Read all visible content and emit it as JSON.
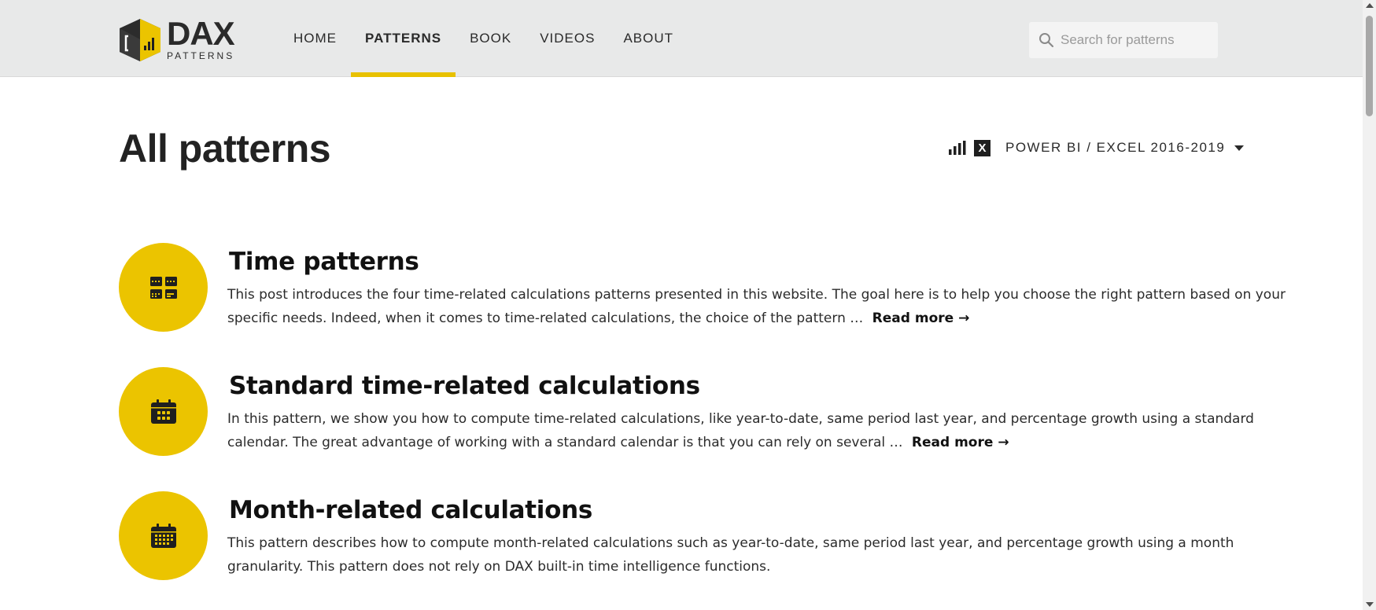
{
  "header": {
    "logo_text": "DAX",
    "logo_sub": "PATTERNS",
    "nav": [
      {
        "label": "HOME",
        "active": false
      },
      {
        "label": "PATTERNS",
        "active": true
      },
      {
        "label": "BOOK",
        "active": false
      },
      {
        "label": "VIDEOS",
        "active": false
      },
      {
        "label": "ABOUT",
        "active": false
      }
    ],
    "search_placeholder": "Search for patterns"
  },
  "page": {
    "title": "All patterns",
    "version_badge": "X",
    "version_label": "POWER BI / EXCEL 2016-2019"
  },
  "patterns": [
    {
      "icon": "calendar-grid-icon",
      "title": "Time patterns",
      "description": "This post introduces the four time-related calculations patterns presented in this website. The goal here is to help you choose the right pattern based on your specific needs. Indeed, when it comes to time-related calculations, the choice of the pattern …",
      "read_more": "Read more"
    },
    {
      "icon": "calendar-icon",
      "title": "Standard time-related calculations",
      "description": "In this pattern, we show you how to compute time-related calculations, like year-to-date, same period last year, and percentage growth using a standard calendar. The great advantage of working with a standard calendar is that you can rely on several …",
      "read_more": "Read more"
    },
    {
      "icon": "calendar-month-icon",
      "title": "Month-related calculations",
      "description": "This pattern describes how to compute month-related calculations such as year-to-date, same period last year, and percentage growth using a month granularity. This pattern does not rely on DAX built-in time intelligence functions.",
      "read_more": ""
    }
  ],
  "colors": {
    "accent": "#ebc400",
    "header_bg": "#e8e9e9",
    "text": "#1f1f1f"
  }
}
